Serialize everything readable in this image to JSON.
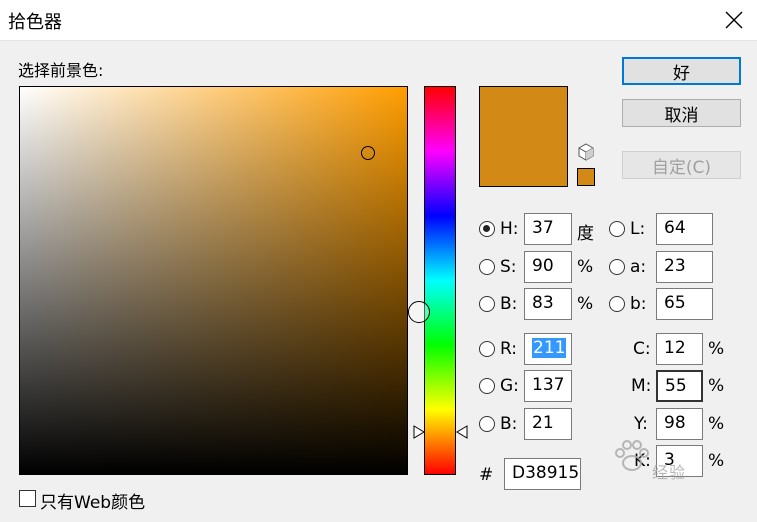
{
  "window": {
    "title": "拾色器"
  },
  "picker": {
    "label": "选择前景色:"
  },
  "buttons": {
    "ok": "好",
    "cancel": "取消",
    "custom": "自定(C)"
  },
  "colors": {
    "current": "#d38915"
  },
  "hsb": {
    "h": {
      "label": "H:",
      "value": "37",
      "unit": "度"
    },
    "s": {
      "label": "S:",
      "value": "90",
      "unit": "%"
    },
    "b": {
      "label": "B:",
      "value": "83",
      "unit": "%"
    }
  },
  "lab": {
    "l": {
      "label": "L:",
      "value": "64"
    },
    "a": {
      "label": "a:",
      "value": "23"
    },
    "b": {
      "label": "b:",
      "value": "65"
    }
  },
  "rgb": {
    "r": {
      "label": "R:",
      "value": "211"
    },
    "g": {
      "label": "G:",
      "value": "137"
    },
    "b": {
      "label": "B:",
      "value": "21"
    }
  },
  "cmyk": {
    "c": {
      "label": "C:",
      "value": "12",
      "unit": "%"
    },
    "m": {
      "label": "M:",
      "value": "55",
      "unit": "%"
    },
    "y": {
      "label": "Y:",
      "value": "98",
      "unit": "%"
    },
    "k": {
      "label": "K:",
      "value": "3",
      "unit": "%"
    }
  },
  "hex": {
    "label": "#",
    "value": "D38915"
  },
  "web_only": {
    "label": "只有Web颜色"
  },
  "watermark": {
    "text": "经验"
  }
}
